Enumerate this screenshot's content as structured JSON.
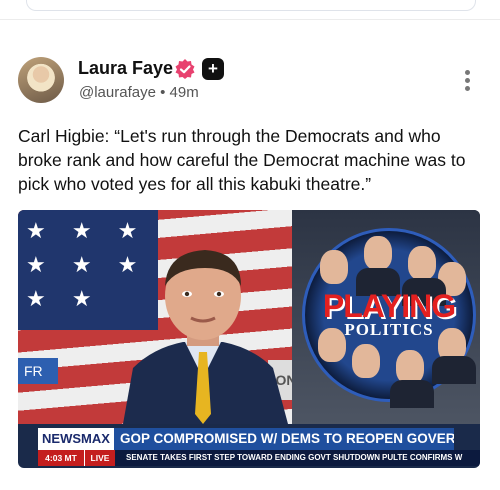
{
  "post": {
    "author_name": "Laura Faye",
    "author_handle": "@laurafaye",
    "separator": "•",
    "time_ago": "49m",
    "text": "Carl Higbie: “Let's run through the Democrats and who broke rank and how careful the Democrat machine was to pick who voted yes for all this kabuki theatre.”",
    "plus_badge": "+"
  },
  "media": {
    "graphic_title": "PLAYING",
    "graphic_subtitle": "POLITICS",
    "wall_text_left": "FR",
    "wall_text_right": "ON",
    "lower_third": {
      "brand": "NEWSMAX",
      "headline": "GOP COMPROMISED W/ DEMS TO REOPEN GOVERNMENT",
      "time": "4:03 MT",
      "live": "LIVE",
      "ticker_1": "SENATE TAKES FIRST STEP TOWARD ENDING GOVT SHUTDOWN",
      "ticker_2": "PULTE CONFIRMS W"
    }
  },
  "colors": {
    "verified_badge": "#e8416f",
    "headline_bar": "#1f4f9e",
    "live_red": "#c41e1e"
  },
  "icons": [
    "verified-badge-icon",
    "plus-badge-icon",
    "more-options-icon"
  ]
}
